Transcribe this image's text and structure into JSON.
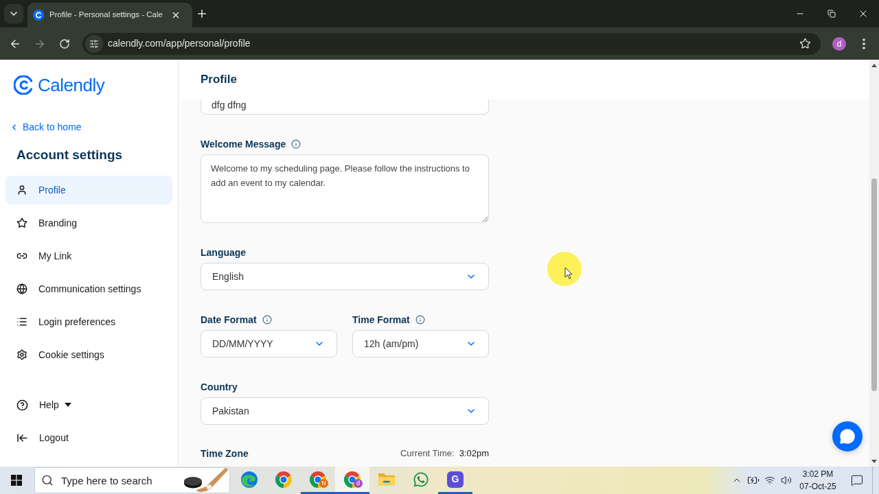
{
  "browser": {
    "tabs": [
      {
        "title": "Profile - Personal settings - Cale",
        "selected": true
      }
    ],
    "back_disabled": false,
    "forward_disabled": true,
    "url": "calendly.com/app/personal/profile",
    "profile_initial": "d"
  },
  "sidebar": {
    "logo": "Calendly",
    "back_link": "Back to home",
    "heading": "Account settings",
    "items": [
      {
        "label": "Profile",
        "selected": true
      },
      {
        "label": "Branding",
        "selected": false
      },
      {
        "label": "My Link",
        "selected": false
      },
      {
        "label": "Communication settings",
        "selected": false
      },
      {
        "label": "Login preferences",
        "selected": false
      },
      {
        "label": "Cookie settings",
        "selected": false
      }
    ],
    "footer_items": [
      {
        "label": "Help",
        "kind": "menu"
      },
      {
        "label": "Logout",
        "kind": "action"
      }
    ]
  },
  "main": {
    "title": "Profile",
    "name_value": "dfg dfng",
    "welcome_message": {
      "label": "Welcome Message",
      "info": true,
      "value": "Welcome to my scheduling page. Please follow the instructions to add an event to my calendar."
    },
    "language": {
      "label": "Language",
      "value": "English"
    },
    "date_format": {
      "label": "Date Format",
      "info": true,
      "value": "DD/MM/YYYY"
    },
    "time_format": {
      "label": "Time Format",
      "info": true,
      "value": "12h (am/pm)"
    },
    "country": {
      "label": "Country",
      "value": "Pakistan"
    },
    "time_zone": {
      "label": "Time Zone",
      "current_time_label": "Current Time:",
      "current_time": "3:02pm"
    }
  },
  "taskbar": {
    "search_placeholder": "Type here to search",
    "apps": [
      {
        "kind": "edge",
        "running": false,
        "selected": false
      },
      {
        "kind": "chrome",
        "running": false,
        "selected": false
      },
      {
        "kind": "chrome",
        "badge": "N",
        "color": "#e8710a",
        "running": true,
        "selected": false
      },
      {
        "kind": "chrome",
        "badge": "d",
        "color": "#a64fc4",
        "running": true,
        "selected": true
      },
      {
        "kind": "folder",
        "running": false,
        "selected": false
      },
      {
        "kind": "whatsapp",
        "running": false,
        "selected": false
      },
      {
        "kind": "tile",
        "letter": "G",
        "running": true,
        "selected": false
      }
    ],
    "time": "3:02 PM",
    "date": "07-Oct-25"
  }
}
